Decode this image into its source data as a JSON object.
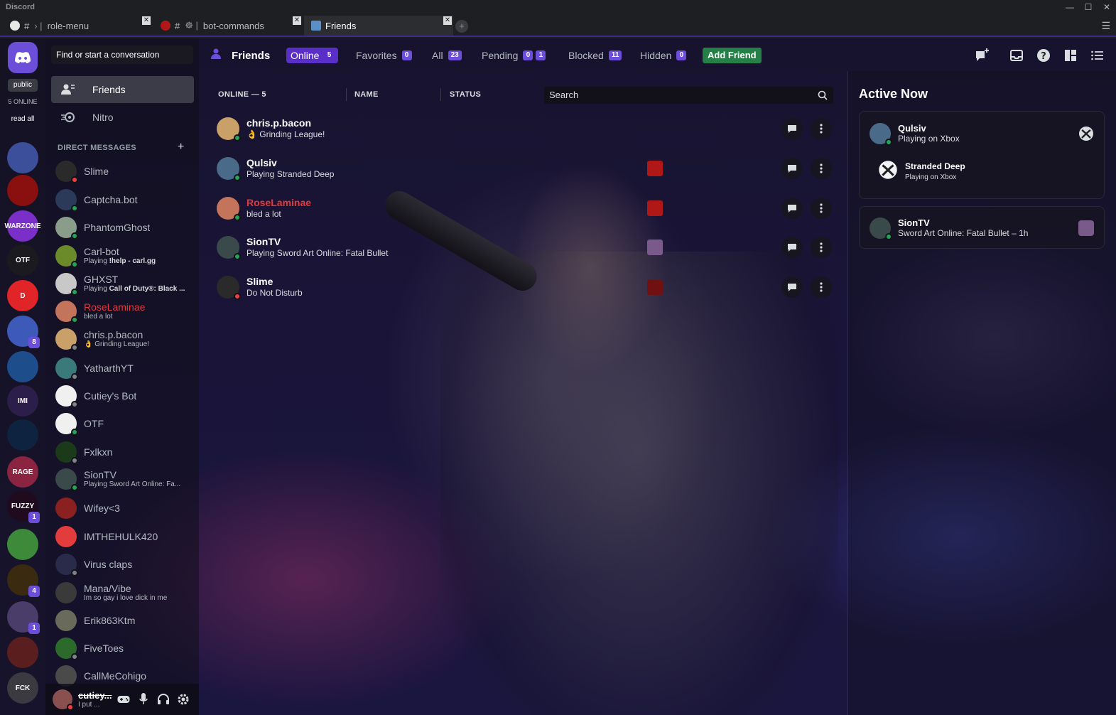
{
  "app": {
    "title": "Discord"
  },
  "tabs": [
    {
      "prefix": "#",
      "label": "role-menu"
    },
    {
      "prefix": "#",
      "label": "bot-commands"
    },
    {
      "label": "Friends"
    }
  ],
  "rail": {
    "public_label": "public",
    "online_label": "5 ONLINE",
    "read_all": "read all",
    "servers": [
      {
        "name": "server-1",
        "color": "#3c4f9a"
      },
      {
        "name": "server-2",
        "color": "#8a1010"
      },
      {
        "name": "WARZONE",
        "text": "WARZONE",
        "color": "#7b2fc9"
      },
      {
        "name": "OTF",
        "text": "OTF",
        "color": "#1b1b1f"
      },
      {
        "name": "server-5",
        "text": "D",
        "color": "#e02428"
      },
      {
        "name": "server-6",
        "color": "#3d5ab8",
        "mention": "8"
      },
      {
        "name": "server-7",
        "color": "#1e4d8c"
      },
      {
        "name": "IMI",
        "text": "IMI",
        "color": "#2c1e4a"
      },
      {
        "name": "windows",
        "color": "#0d2340"
      },
      {
        "name": "server-10",
        "text": "RAGE",
        "color": "#8b2440"
      },
      {
        "name": "FUZZY",
        "text": "FUZZY",
        "color": "#200a1e",
        "mention": "1"
      },
      {
        "name": "pepe",
        "color": "#3d8a3a"
      },
      {
        "name": "server-13",
        "color": "#3a2a10",
        "mention": "4"
      },
      {
        "name": "server-14",
        "color": "#4a3d6a",
        "mention": "1"
      },
      {
        "name": "server-15",
        "color": "#5a1e1e"
      },
      {
        "name": "FCK",
        "text": "FCK",
        "color": "#3a3a40"
      }
    ]
  },
  "dm": {
    "search_placeholder": "Find or start a conversation",
    "nav": {
      "friends": "Friends",
      "nitro": "Nitro"
    },
    "header": "DIRECT MESSAGES",
    "items": [
      {
        "name": "Slime",
        "status": "dnd",
        "color": "#2a2a2a"
      },
      {
        "name": "Captcha.bot",
        "status": "on",
        "color": "#2b3a58"
      },
      {
        "name": "PhantomGhost",
        "status": "on",
        "color": "#8a9c8a"
      },
      {
        "name": "Carl-bot",
        "status": "on",
        "color": "#6b8a2a",
        "sub_pre": "Playing ",
        "sub_b": "!help - carl.gg"
      },
      {
        "name": "GHXST",
        "status": "on",
        "color": "#c8c8c8",
        "sub_pre": "Playing ",
        "sub_b": "Call of Duty®: Black ..."
      },
      {
        "name": "RoseLaminae",
        "status": "on",
        "color": "#c4745a",
        "red": true,
        "sub": "bled a lot"
      },
      {
        "name": "chris.p.bacon",
        "status": "idle",
        "color": "#c8a068",
        "sub": "👌 Grinding League!"
      },
      {
        "name": "YatharthYT",
        "status": "idle",
        "color": "#3a7a7a"
      },
      {
        "name": "Cutiey's Bot",
        "status": "idle",
        "color": "#f0f0f0"
      },
      {
        "name": "OTF",
        "status": "on",
        "color": "#f0f0f0"
      },
      {
        "name": "Fxlkxn",
        "status": "idle",
        "color": "#1a3a1a"
      },
      {
        "name": "SionTV",
        "status": "on",
        "color": "#3a4a4a",
        "sub": "Playing Sword Art Online: Fa..."
      },
      {
        "name": "Wifey<3",
        "status": "",
        "color": "#8a2020"
      },
      {
        "name": "IMTHEHULK420",
        "status": "",
        "color": "#e23c3c"
      },
      {
        "name": "Virus claps",
        "status": "idle",
        "color": "#2a2a4a"
      },
      {
        "name": "Mana/Vibe",
        "status": "",
        "color": "#3a3a3a",
        "sub": "Im so gay i love dick in me"
      },
      {
        "name": "Erik863Ktm",
        "status": "",
        "color": "#6a6a5a"
      },
      {
        "name": "FiveToes",
        "status": "idle",
        "color": "#2c6a2c"
      },
      {
        "name": "CallMeCohigo",
        "status": "",
        "color": "#4a4a4a"
      }
    ]
  },
  "user": {
    "name": "cutiey...",
    "status": "I put ..."
  },
  "friends": {
    "title": "Friends",
    "tabs": [
      {
        "label": "Online",
        "count": "5"
      },
      {
        "label": "Favorites",
        "count": "0"
      },
      {
        "label": "All",
        "count": "23"
      },
      {
        "label": "Pending",
        "count": "0",
        "count2": "1"
      },
      {
        "label": "Blocked",
        "count": "11"
      },
      {
        "label": "Hidden",
        "count": "0"
      }
    ],
    "add_friend": "Add Friend",
    "columns": {
      "online": "ONLINE — 5",
      "name": "NAME",
      "status": "STATUS"
    },
    "search_placeholder": "Search",
    "rows": [
      {
        "name": "chris.p.bacon",
        "sub": "👌 Grinding League!",
        "status": "on",
        "color": "#c8a068"
      },
      {
        "name": "Qulsiv",
        "sub": "Playing Stranded Deep",
        "status": "on",
        "color": "#4a6a8a",
        "game_color": "#b01818"
      },
      {
        "name": "RoseLaminae",
        "sub": "bled a lot",
        "status": "on",
        "color": "#c4745a",
        "red": true,
        "game_color": "#b01818"
      },
      {
        "name": "SionTV",
        "sub": "Playing Sword Art Online: Fatal Bullet",
        "status": "on",
        "color": "#3a4a4a",
        "game_color": "#7a5a8a"
      },
      {
        "name": "Slime",
        "sub": "Do Not Disturb",
        "status": "dnd",
        "color": "#2a2a2a",
        "game_color": "#701010"
      }
    ]
  },
  "active_now": {
    "title": "Active Now",
    "cards": [
      {
        "name": "Qulsiv",
        "sub": "Playing on Xbox",
        "detail_name": "Stranded Deep",
        "detail_sub": "Playing on Xbox"
      },
      {
        "name": "SionTV",
        "sub": "Sword Art Online: Fatal Bullet – 1h"
      }
    ]
  }
}
